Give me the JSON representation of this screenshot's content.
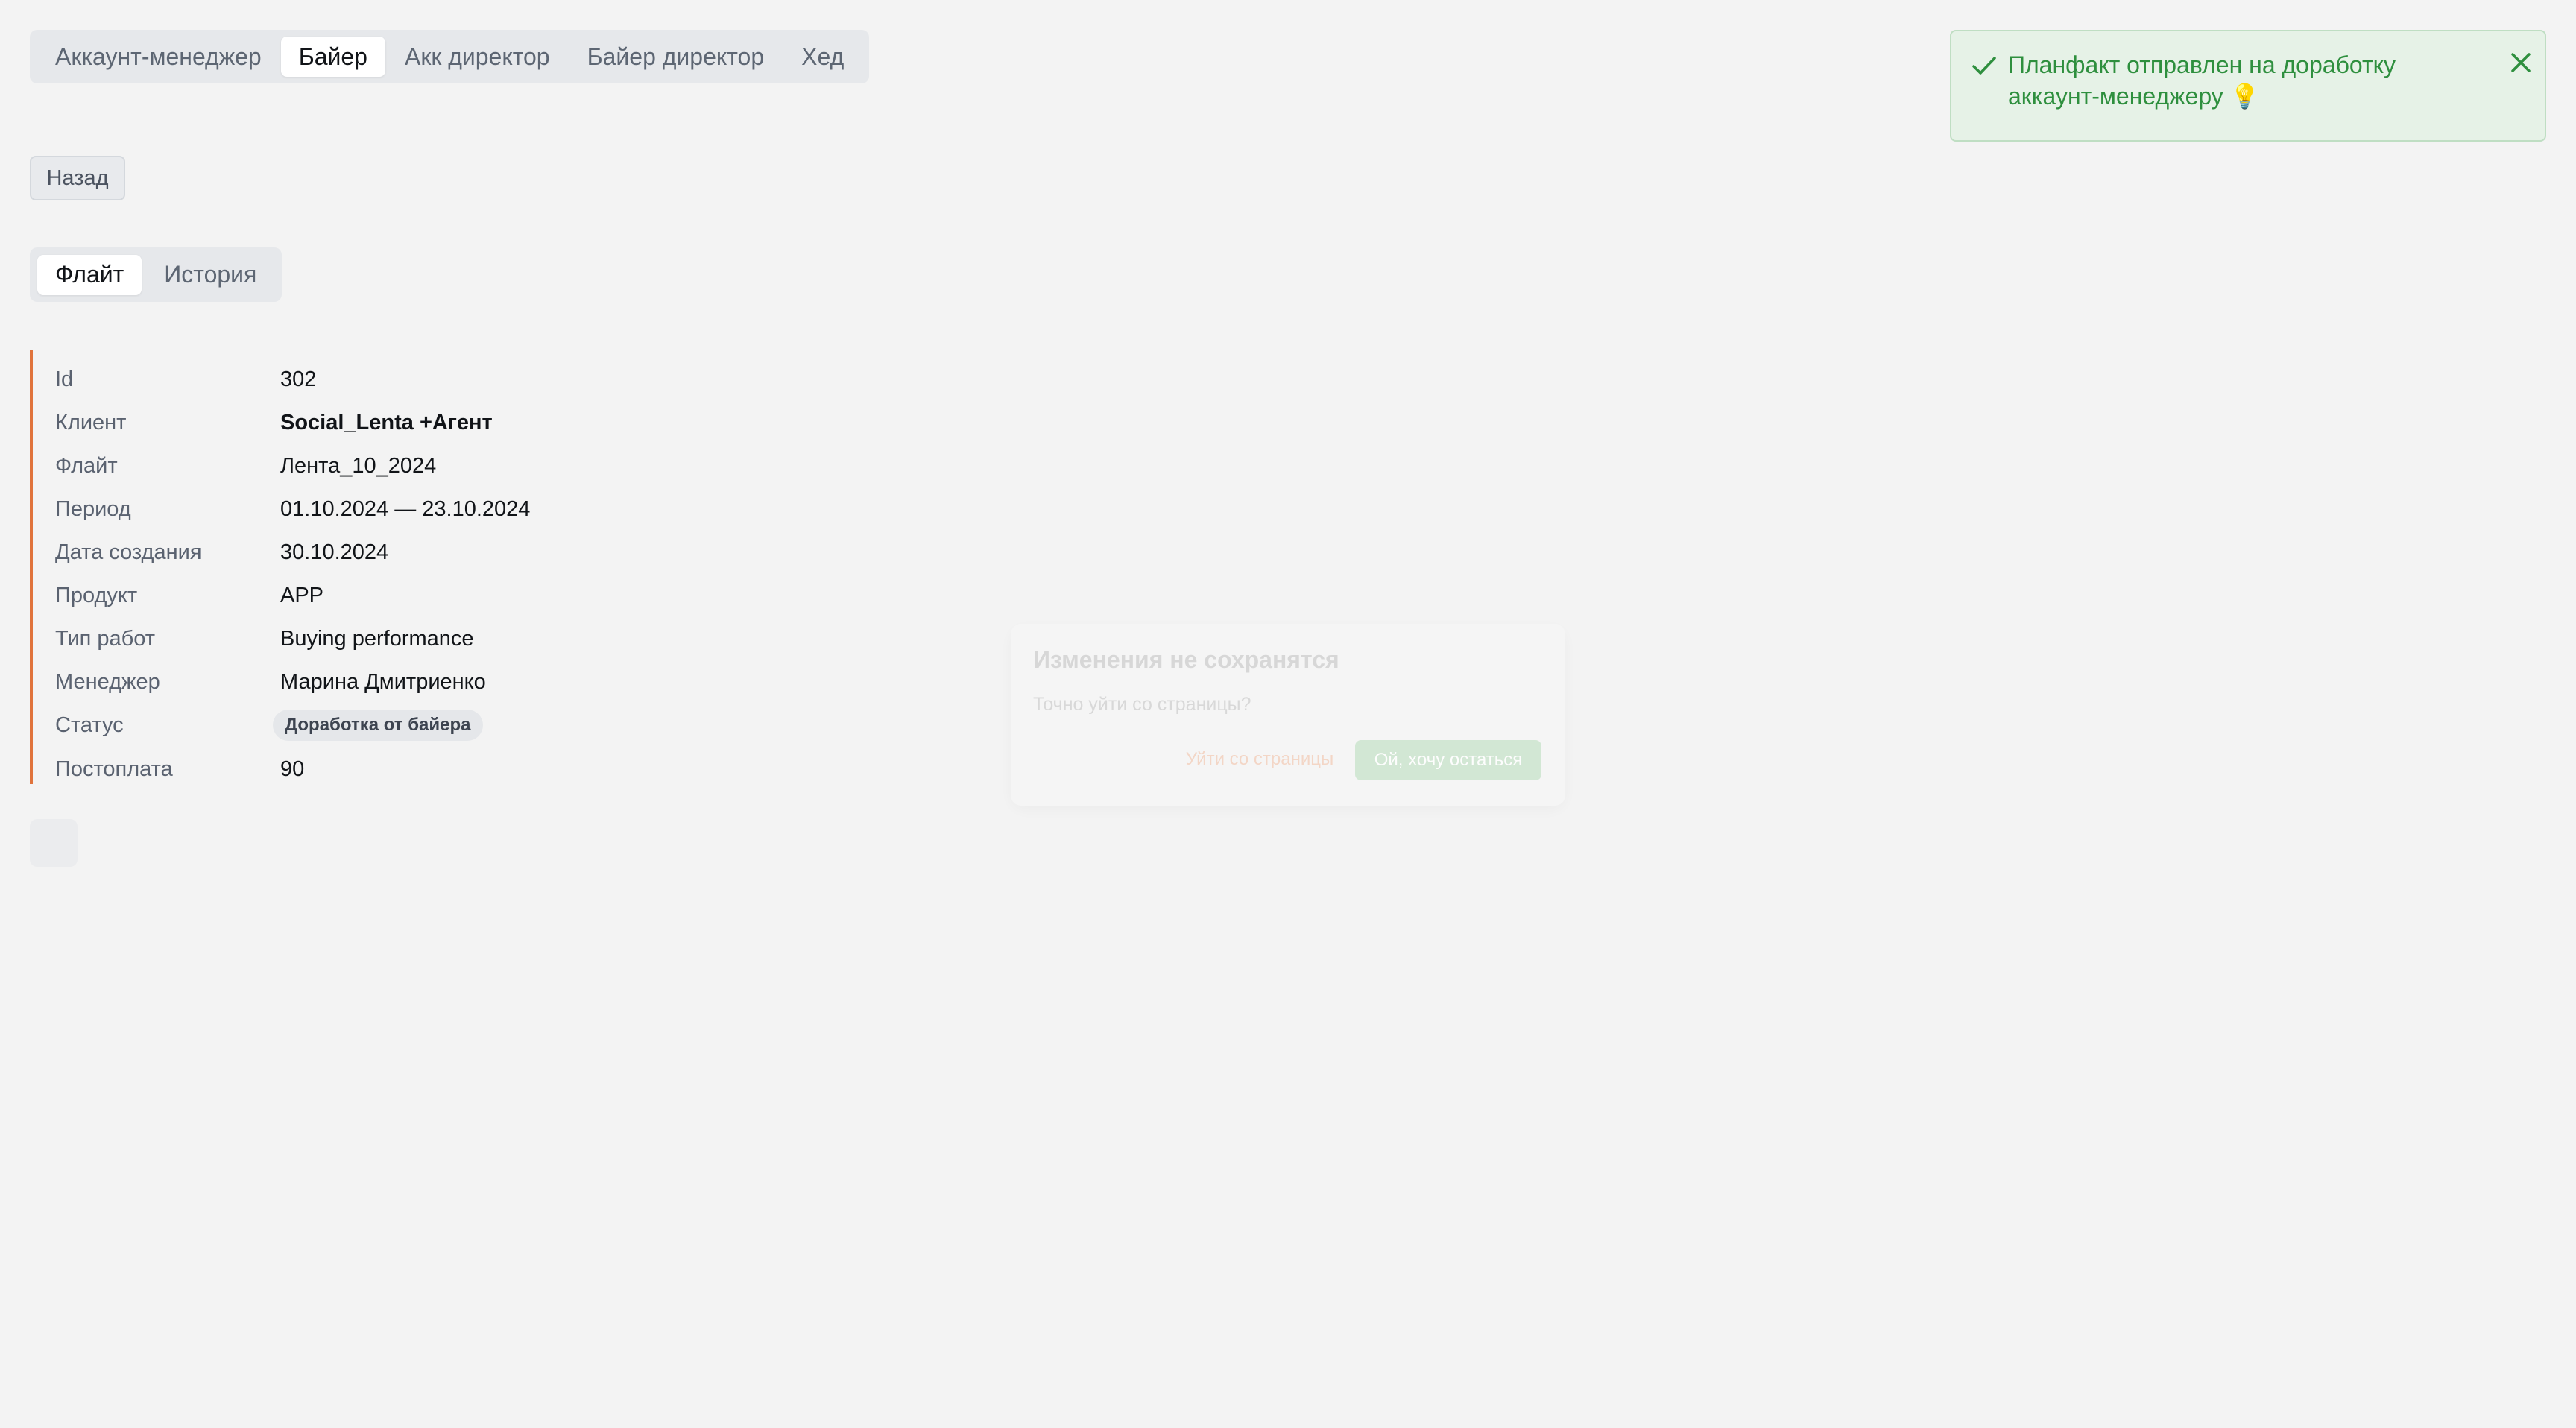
{
  "roles": {
    "items": [
      {
        "label": "Аккаунт-менеджер",
        "active": false
      },
      {
        "label": "Байер",
        "active": true
      },
      {
        "label": "Акк директор",
        "active": false
      },
      {
        "label": "Байер директор",
        "active": false
      },
      {
        "label": "Хед",
        "active": false
      }
    ]
  },
  "back_label": "Назад",
  "tabs": {
    "items": [
      {
        "label": "Флайт",
        "active": true
      },
      {
        "label": "История",
        "active": false
      }
    ]
  },
  "details": {
    "accent_color": "#e0733c",
    "rows": [
      {
        "label": "Id",
        "value": "302"
      },
      {
        "label": "Клиент",
        "value": "Social_Lenta +Агент"
      },
      {
        "label": "Флайт",
        "value": "Лента_10_2024"
      },
      {
        "label": "Период",
        "value": "01.10.2024 — 23.10.2024"
      },
      {
        "label": "Дата создания",
        "value": "30.10.2024"
      },
      {
        "label": "Продукт",
        "value": "APP"
      },
      {
        "label": "Тип работ",
        "value": "Buying performance"
      },
      {
        "label": "Менеджер",
        "value": "Марина Дмитриенко"
      },
      {
        "label": "Статус",
        "value": "Доработка от байера"
      },
      {
        "label": "Постоплата",
        "value": "90"
      }
    ]
  },
  "modal": {
    "title": "Изменения не сохранятся",
    "text": "Точно уйти со страницы?",
    "leave_label": "Уйти со страницы",
    "stay_label": "Ой, хочу остаться"
  },
  "toast": {
    "message": "Планфакт отправлен на доработку аккаунт-менеджеру 💡",
    "icon": "check-icon",
    "close_icon": "close-icon",
    "color": "#2e8f3e"
  }
}
